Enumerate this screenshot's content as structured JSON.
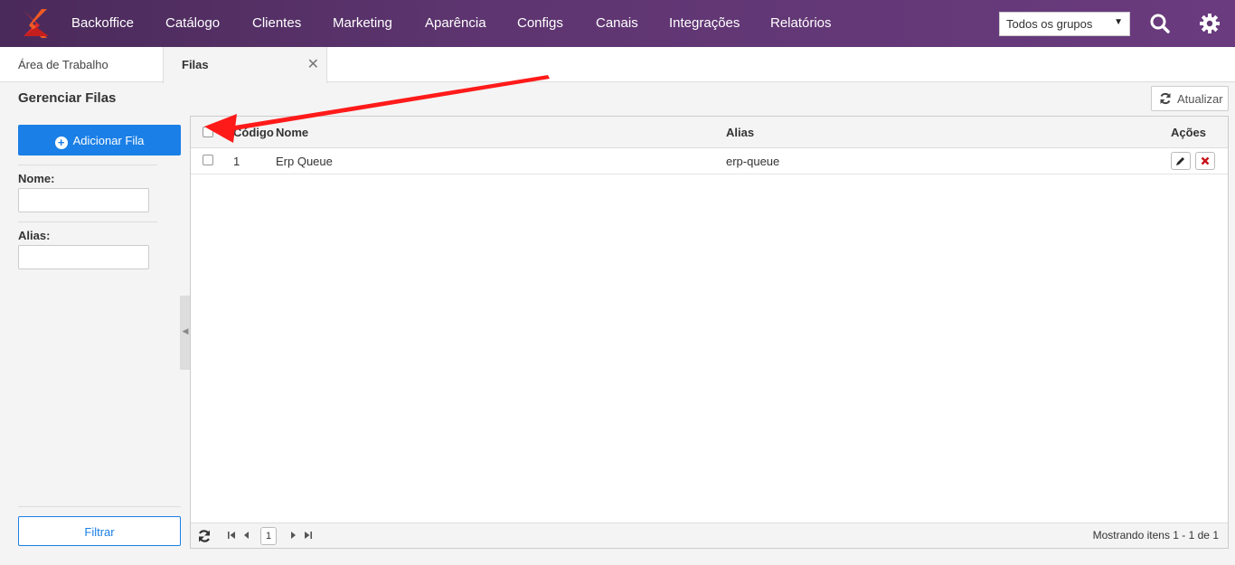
{
  "nav": {
    "items": [
      "Backoffice",
      "Catálogo",
      "Clientes",
      "Marketing",
      "Aparência",
      "Configs",
      "Canais",
      "Integrações",
      "Relatórios"
    ],
    "group_select": "Todos os grupos",
    "brand_colors": {
      "bar_start": "#4a2a5a",
      "bar_end": "#6a3b7e",
      "logo_orange": "#f15a24",
      "logo_red": "#e02a2a"
    }
  },
  "tabs": [
    {
      "label": "Área de Trabalho",
      "active": false
    },
    {
      "label": "Filas",
      "active": true
    }
  ],
  "page": {
    "title": "Gerenciar Filas",
    "refresh_label": "Atualizar"
  },
  "sidebar": {
    "add_label": "Adicionar Fila",
    "name_label": "Nome:",
    "alias_label": "Alias:",
    "filter_label": "Filtrar",
    "accent": "#1a7fe6"
  },
  "grid": {
    "columns": [
      "Código",
      "Nome",
      "Alias",
      "Ações"
    ],
    "rows": [
      {
        "codigo": "1",
        "nome": "Erp Queue",
        "alias": "erp-queue"
      }
    ],
    "page": "1",
    "footer_info": "Mostrando itens 1 - 1 de 1"
  },
  "annotation": {
    "color": "#ff1a1a"
  }
}
